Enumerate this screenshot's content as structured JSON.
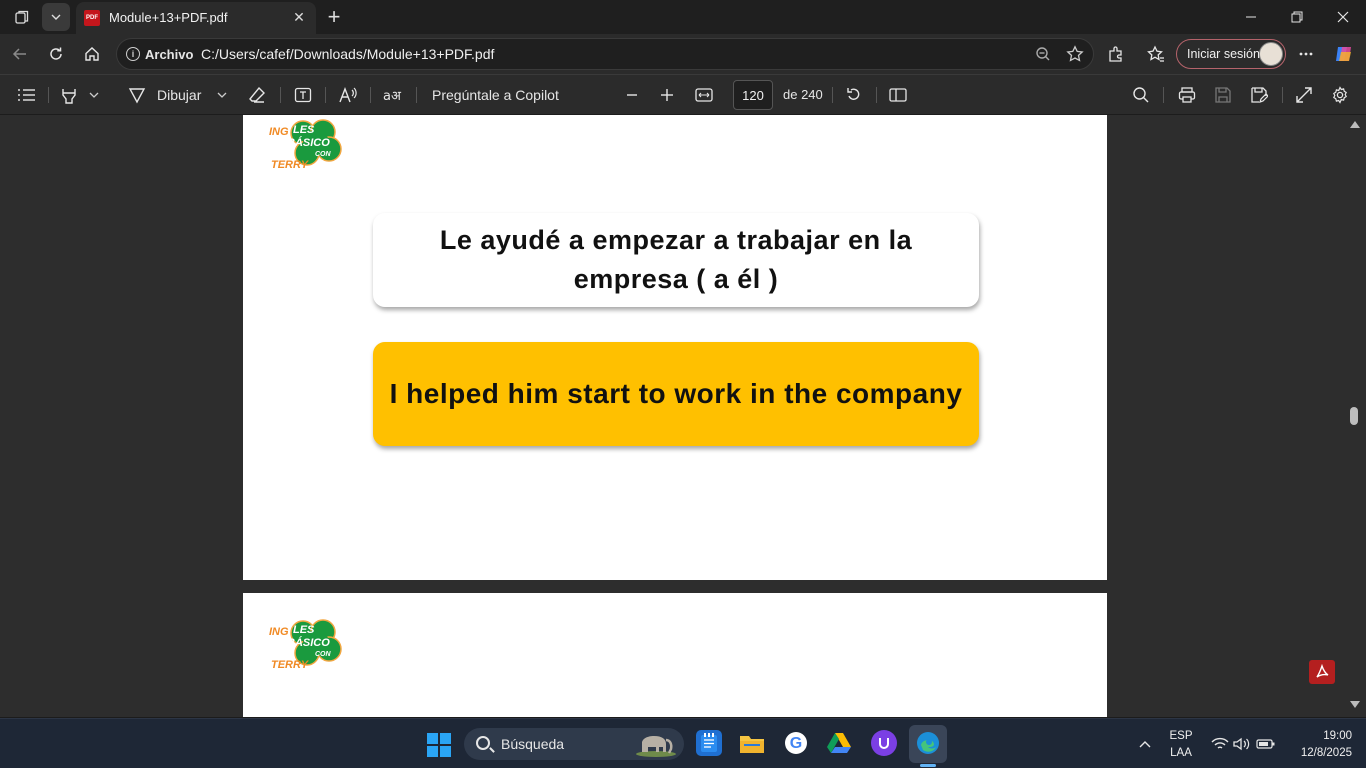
{
  "browser": {
    "tab_title": "Module+13+PDF.pdf",
    "tab_favicon": "PDF",
    "address_label": "Archivo",
    "url": "C:/Users/cafef/Downloads/Module+13+PDF.pdf",
    "signin_label": "Iniciar sesión"
  },
  "pdf_toolbar": {
    "draw_label": "Dibujar",
    "copilot_label": "Pregúntale a Copilot",
    "current_page": "120",
    "total_pages": "de 240"
  },
  "document": {
    "logo": {
      "ing": "ING",
      "les": "LES",
      "basico": "BÁSICO",
      "con": "CON",
      "terry": "TERRY"
    },
    "spanish_sentence": "Le ayudé a empezar a trabajar en la empresa ( a él )",
    "english_sentence": "I helped him start to work in the company"
  },
  "taskbar": {
    "search_placeholder": "Búsqueda",
    "lang_top": "ESP",
    "lang_bottom": "LAA",
    "time": "19:00",
    "date": "12/8/2025"
  },
  "colors": {
    "answer_card": "#ffc000",
    "logo_orange": "#f08a24",
    "logo_green": "#1a9a3e",
    "acrobat_red": "#b41f1f"
  }
}
